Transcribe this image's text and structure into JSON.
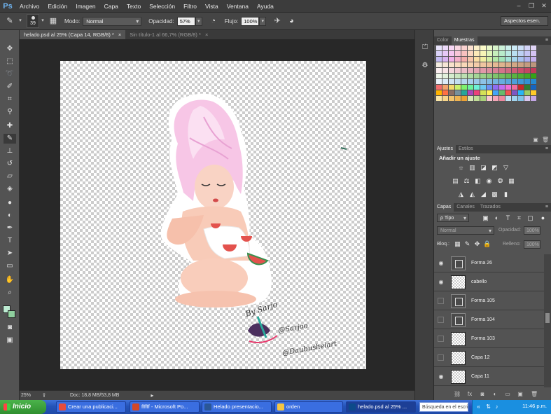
{
  "app": {
    "logo": "Ps"
  },
  "menu": [
    "Archivo",
    "Edición",
    "Imagen",
    "Capa",
    "Texto",
    "Selección",
    "Filtro",
    "Vista",
    "Ventana",
    "Ayuda"
  ],
  "options": {
    "brush_size": "39",
    "mode_label": "Modo:",
    "mode_value": "Normal",
    "opacity_label": "Opacidad:",
    "opacity_value": "57%",
    "flow_label": "Flujo:",
    "flow_value": "100%",
    "workspace": "Aspectos esen."
  },
  "tabs": [
    {
      "label": "helado.psd al 25% (Capa 14, RGB/8) *",
      "close": "×"
    },
    {
      "label": "Sin título-1 al 66,7% (RGB/8) *",
      "close": "×"
    }
  ],
  "status": {
    "zoom": "25%",
    "doc": "Doc: 18,8 MB/53,8 MB"
  },
  "color_panel": {
    "tabs": [
      "Color",
      "Muestras"
    ],
    "swatch_colors": [
      "#e7e3fb",
      "#ecd9f9",
      "#f7d6f4",
      "#fad6e2",
      "#fad2d0",
      "#fce1cf",
      "#fdf1c9",
      "#fbfac8",
      "#e9f8c8",
      "#d7f4ca",
      "#ccf1d9",
      "#ccf0ec",
      "#cbeaf6",
      "#ccdff7",
      "#d3d4f7",
      "#e0d4f6",
      "#dad2f8",
      "#e6c9f7",
      "#f5c5ef",
      "#f8c5d7",
      "#f8c1bf",
      "#fad5bf",
      "#fce9b8",
      "#f7f5b7",
      "#dff4b9",
      "#c6eebb",
      "#b9eccb",
      "#bae9e3",
      "#badff1",
      "#bcd0f3",
      "#c4c4f3",
      "#d4c3f2",
      "#c5bdf3",
      "#d9b5f2",
      "#f0b1e8",
      "#f4b0c9",
      "#f4aeab",
      "#f7c6ab",
      "#fadea4",
      "#f2efa3",
      "#d2ee a6",
      "#b3e8a7",
      "#a4e5bb",
      "#a6e2d9",
      "#a6d5ec",
      "#a8c2ef",
      "#b1b1ef",
      "#c6b0ee",
      "#f3ece1",
      "#f6e6d6",
      "#f8e2cc",
      "#f9ddc1",
      "#f8d8b8",
      "#f6d2b0",
      "#f3cca8",
      "#efc6a1",
      "#eac09a",
      "#e5ba94",
      "#dfb48f",
      "#d9ae8a",
      "#d2a886",
      "#cba283",
      "#c39c80",
      "#bb967d",
      "#fbeff0",
      "#f8e3e6",
      "#f4d6dc",
      "#f0c9d1",
      "#ecbdc7",
      "#e8b1bd",
      "#e4a5b3",
      "#e099a9",
      "#dc8d9f",
      "#d88195",
      "#d4758b",
      "#d06981",
      "#cc5d77",
      "#c8516d",
      "#c44563",
      "#c03959",
      "#eef7ea",
      "#e2f1dc",
      "#d5ecce",
      "#c9e6c0",
      "#bde0b2",
      "#b0dba4",
      "#a4d596",
      "#98cf88",
      "#8bca7a",
      "#7fc46c",
      "#73be5e",
      "#66b950",
      "#5ab342",
      "#4ead34",
      "#41a826",
      "#35a218",
      "#e9f3fb",
      "#dcecf8",
      "#cfe5f5",
      "#c2def2",
      "#b5d7ef",
      "#a8d0ec",
      "#9bc9e9",
      "#8ec2e6",
      "#81bbe3",
      "#74b4e0",
      "#67ade0",
      "#5aa6dd",
      "#4d9fda",
      "#4098d7",
      "#3391d4",
      "#268ad1",
      "#f26d6d",
      "#f2a36d",
      "#f2d86d",
      "#c8f26d",
      "#7ef26d",
      "#6df29e",
      "#6df2d6",
      "#6dc8f2",
      "#6d8ff2",
      "#8f6df2",
      "#c26df2",
      "#f26dd6",
      "#f26d9e",
      "#c62828",
      "#2e7d32",
      "#1565c0",
      "#ffb300",
      "#ff7043",
      "#8d6e63",
      "#78909c",
      "#26a69a",
      "#ab47bc",
      "#ec407a",
      "#d4e157",
      "#ffee58",
      "#42a5f5",
      "#66bb6a",
      "#ef5350",
      "#7e57c2",
      "#29b6f6",
      "#9ccc65",
      "#ffca28",
      "#fbe7a8",
      "#f7d58b",
      "#f3c46e",
      "#efb351",
      "#eba134",
      "#d8e7b6",
      "#c1dc98",
      "#aad17a",
      "#f9c6d1",
      "#f3a6b7",
      "#ed879d",
      "#bfe2f4",
      "#a1d3ee",
      "#83c4e8",
      "#d9c6ef",
      "#c3a6e6"
    ]
  },
  "adjustments": {
    "tabs": [
      "Ajustes",
      "Estilos"
    ],
    "title": "Añadir un ajuste"
  },
  "layers_panel": {
    "tabs": [
      "Capas",
      "Canales",
      "Trazados"
    ],
    "kind_filter": "ρ Tipo",
    "blend_mode": "Normal",
    "opacity_label": "Opacidad:",
    "opacity_value": "100%",
    "lock_label": "Bloq.:",
    "fill_label": "Relleno:",
    "fill_value": "100%",
    "layers": [
      {
        "name": "Forma 26",
        "visible": true,
        "kind": "shape"
      },
      {
        "name": "cabello",
        "visible": true,
        "kind": "pixel"
      },
      {
        "name": "Forma 105",
        "visible": false,
        "kind": "shape"
      },
      {
        "name": "Forma 104",
        "visible": false,
        "kind": "shape"
      },
      {
        "name": "Forma 103",
        "visible": false,
        "kind": "pixel"
      },
      {
        "name": "Capa 12",
        "visible": false,
        "kind": "pixel"
      },
      {
        "name": "Capa 11",
        "visible": true,
        "kind": "pixel"
      }
    ]
  },
  "artwork": {
    "watermark_lines": [
      "By Sarjo",
      "@Sarjoo",
      "@Daubushelart"
    ]
  },
  "taskbar": {
    "start": "Inicio",
    "tasks": [
      {
        "label": "Crear una publicaci...",
        "color": "#e74c3c"
      },
      {
        "label": "ffffff - Microsoft Po...",
        "color": "#d24726"
      },
      {
        "label": "Helado presentacio...",
        "color": "#2b5797"
      },
      {
        "label": "orden",
        "color": "#f5c542"
      },
      {
        "label": "helado.psd al 25% ...",
        "color": "#0c4a8a"
      }
    ],
    "search_placeholder": "Búsqueda en el escri",
    "clock": "11:46 p.m."
  }
}
